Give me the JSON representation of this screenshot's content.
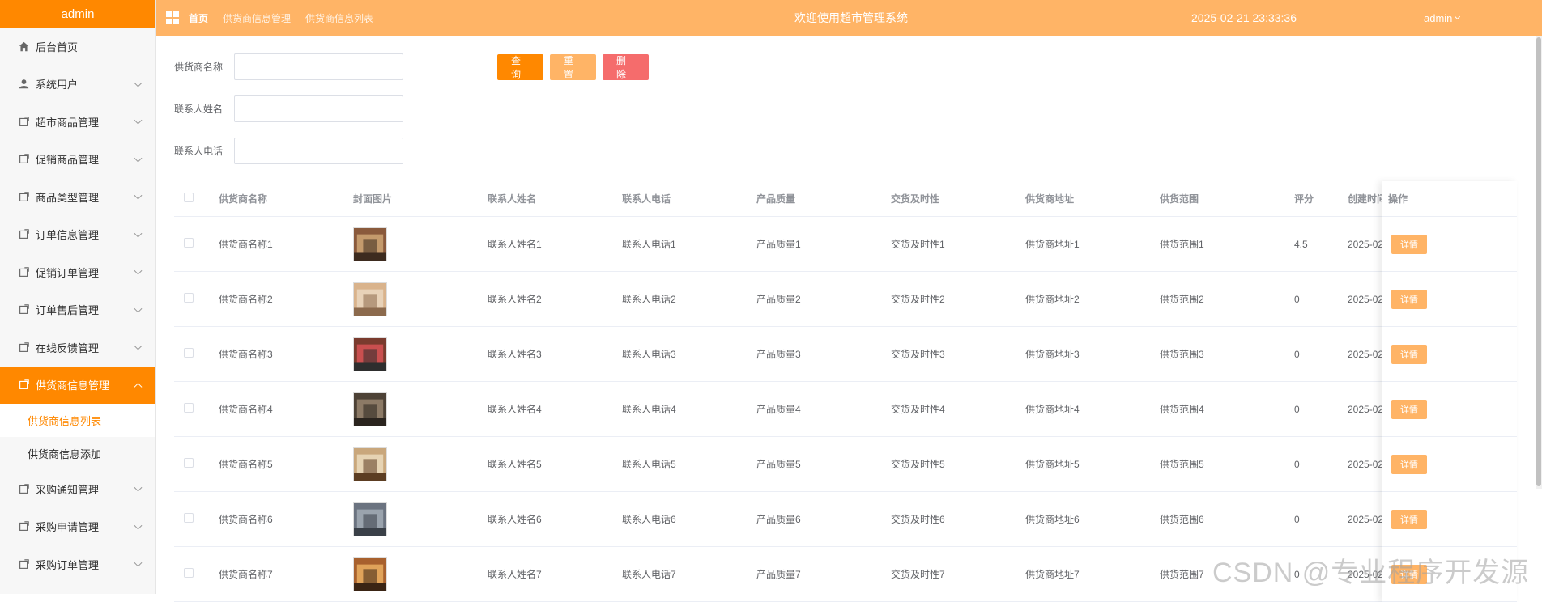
{
  "sidebar": {
    "brand": "admin",
    "items": [
      {
        "label": "后台首页",
        "icon": "home-icon"
      },
      {
        "label": "系统用户",
        "icon": "user-icon"
      },
      {
        "label": "超市商品管理",
        "icon": "doc-icon"
      },
      {
        "label": "促销商品管理",
        "icon": "doc-icon"
      },
      {
        "label": "商品类型管理",
        "icon": "doc-icon"
      },
      {
        "label": "订单信息管理",
        "icon": "doc-icon"
      },
      {
        "label": "促销订单管理",
        "icon": "doc-icon"
      },
      {
        "label": "订单售后管理",
        "icon": "doc-icon"
      },
      {
        "label": "在线反馈管理",
        "icon": "doc-icon"
      },
      {
        "label": "供货商信息管理",
        "icon": "doc-icon"
      },
      {
        "label": "采购通知管理",
        "icon": "doc-icon"
      },
      {
        "label": "采购申请管理",
        "icon": "doc-icon"
      },
      {
        "label": "采购订单管理",
        "icon": "doc-icon"
      }
    ],
    "subitems": [
      {
        "label": "供货商信息列表"
      },
      {
        "label": "供货商信息添加"
      }
    ]
  },
  "header": {
    "breadcrumb": [
      "首页",
      "供货商信息管理",
      "供货商信息列表"
    ],
    "title": "欢迎使用超市管理系统",
    "datetime": "2025-02-21 23:33:36",
    "user": "admin"
  },
  "search": {
    "fields": [
      {
        "label": "供货商名称",
        "value": ""
      },
      {
        "label": "联系人姓名",
        "value": ""
      },
      {
        "label": "联系人电话",
        "value": ""
      }
    ],
    "buttons": {
      "query": "查询",
      "reset": "重置",
      "delete": "删除"
    }
  },
  "table": {
    "columns": [
      "供货商名称",
      "封面图片",
      "联系人姓名",
      "联系人电话",
      "产品质量",
      "交货及时性",
      "供货商地址",
      "供货范围",
      "评分",
      "创建时间",
      "操作"
    ],
    "rows": [
      {
        "name": "供货商名称1",
        "contact": "联系人姓名1",
        "phone": "联系人电话1",
        "quality": "产品质量1",
        "timely": "交货及时性1",
        "address": "供货商地址1",
        "scope": "供货范围1",
        "score": "4.5",
        "created": "2025-02",
        "action": "详情"
      },
      {
        "name": "供货商名称2",
        "contact": "联系人姓名2",
        "phone": "联系人电话2",
        "quality": "产品质量2",
        "timely": "交货及时性2",
        "address": "供货商地址2",
        "scope": "供货范围2",
        "score": "0",
        "created": "2025-02",
        "action": "详情"
      },
      {
        "name": "供货商名称3",
        "contact": "联系人姓名3",
        "phone": "联系人电话3",
        "quality": "产品质量3",
        "timely": "交货及时性3",
        "address": "供货商地址3",
        "scope": "供货范围3",
        "score": "0",
        "created": "2025-02",
        "action": "详情"
      },
      {
        "name": "供货商名称4",
        "contact": "联系人姓名4",
        "phone": "联系人电话4",
        "quality": "产品质量4",
        "timely": "交货及时性4",
        "address": "供货商地址4",
        "scope": "供货范围4",
        "score": "0",
        "created": "2025-02",
        "action": "详情"
      },
      {
        "name": "供货商名称5",
        "contact": "联系人姓名5",
        "phone": "联系人电话5",
        "quality": "产品质量5",
        "timely": "交货及时性5",
        "address": "供货商地址5",
        "scope": "供货范围5",
        "score": "0",
        "created": "2025-02",
        "action": "详情"
      },
      {
        "name": "供货商名称6",
        "contact": "联系人姓名6",
        "phone": "联系人电话6",
        "quality": "产品质量6",
        "timely": "交货及时性6",
        "address": "供货商地址6",
        "scope": "供货范围6",
        "score": "0",
        "created": "2025-02",
        "action": "详情"
      },
      {
        "name": "供货商名称7",
        "contact": "联系人姓名7",
        "phone": "联系人电话7",
        "quality": "产品质量7",
        "timely": "交货及时性7",
        "address": "供货商地址7",
        "scope": "供货范围7",
        "score": "0",
        "created": "2025-02",
        "action": "详情"
      }
    ]
  },
  "watermark": "CSDN @专业程序开发源",
  "colors": {
    "primary": "#ff8800",
    "header": "#ffb466",
    "danger": "#f56c6c"
  }
}
